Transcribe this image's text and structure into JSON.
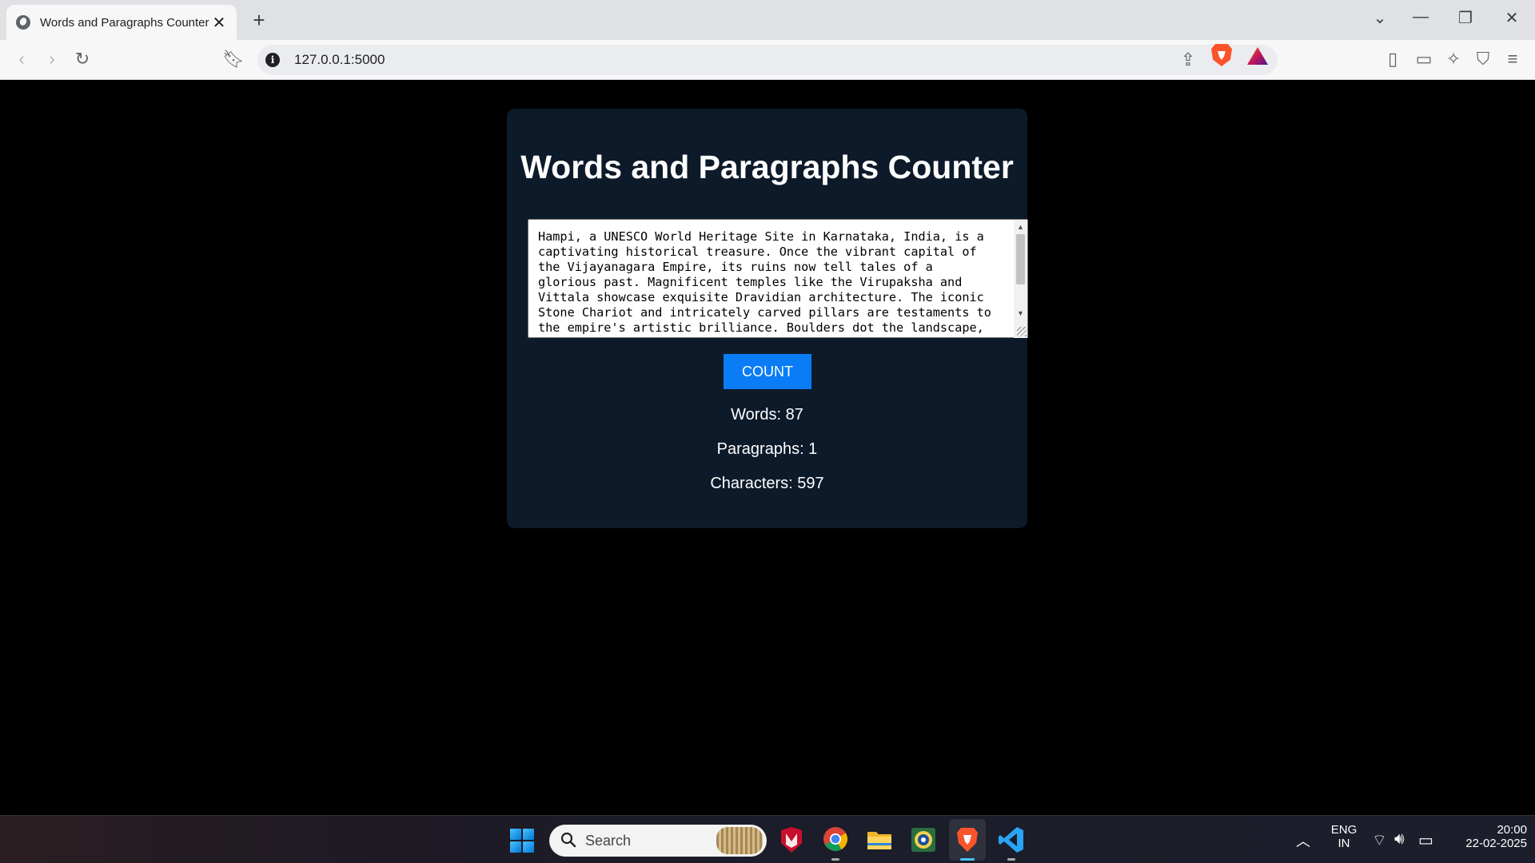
{
  "browser": {
    "tab_title": "Words and Paragraphs Counter",
    "tab_close": "✕",
    "new_tab": "+",
    "url": "127.0.0.1:5000",
    "window_controls": {
      "dropdown": "⌄",
      "minimize": "—",
      "restore": "❐",
      "close": "✕"
    }
  },
  "page": {
    "title": "Words and Paragraphs Counter",
    "textarea_text": "Hampi, a UNESCO World Heritage Site in Karnataka, India, is a captivating historical treasure. Once the vibrant capital of the Vijayanagara Empire, its ruins now tell tales of a glorious past. Magnificent temples like the Virupaksha and Vittala showcase exquisite Dravidian architecture. The iconic Stone Chariot and intricately carved pillars are testaments to the empire's artistic brilliance. Boulders dot the landscape, adding a surreal touch to this ancient city.",
    "count_button": "COUNT",
    "words": "Words: 87",
    "paragraphs": "Paragraphs: 1",
    "characters": "Characters: 597"
  },
  "taskbar": {
    "search_placeholder": "Search",
    "lang_line1": "ENG",
    "lang_line2": "IN",
    "time": "20:00",
    "date": "22-02-2025"
  },
  "colors": {
    "card_bg": "#0d1a2a",
    "button_bg": "#0a7cf5",
    "page_bg": "#000000"
  }
}
